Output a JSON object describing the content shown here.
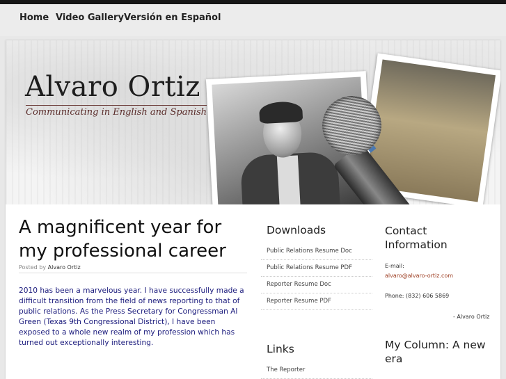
{
  "nav": {
    "items": [
      "Home",
      "Video Gallery",
      "Versión en Español"
    ]
  },
  "header": {
    "title": "Alvaro Ortiz",
    "tagline": "Communicating in English and Spanish"
  },
  "post": {
    "title": "A magnificent year for my professional career",
    "posted_by_label": "Posted by",
    "author": "Alvaro Ortiz",
    "body": "2010 has been a marvelous year. I have successfully made a difficult transition from the field of news reporting to that of public relations. As the Press Secretary for Congressman Al Green (Texas 9th Congressional District), I have been exposed to a whole new realm of my profession which has turned out exceptionally interesting."
  },
  "downloads": {
    "heading": "Downloads",
    "items": [
      "Public Relations Resume Doc",
      "Public Relations Resume PDF",
      "Reporter Resume Doc",
      "Reporter Resume PDF"
    ]
  },
  "links": {
    "heading": "Links",
    "items": [
      "The Reporter"
    ]
  },
  "contact": {
    "heading": "Contact Information",
    "email_label": "E-mail:",
    "email": "alvaro@alvaro-ortiz.com",
    "phone": "Phone: (832) 606 5869",
    "signature": "- Alvaro Ortiz"
  },
  "column": {
    "heading": "My Column: A new era"
  },
  "colors": {
    "topbar": "#161616",
    "nav_bg": "#ececec",
    "body_text": "#1a1a7c",
    "link_accent": "#9b3a1e",
    "tagline": "#5a2c2a"
  }
}
